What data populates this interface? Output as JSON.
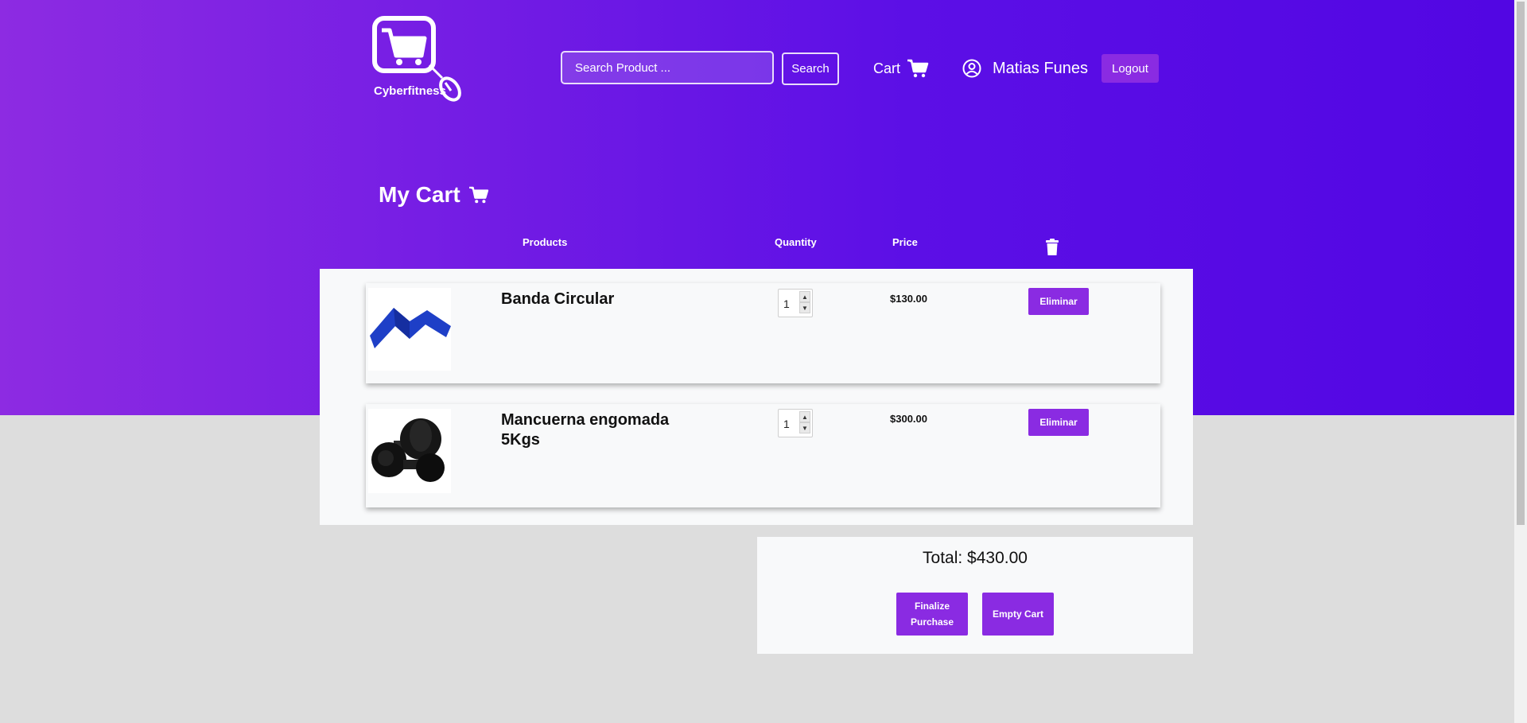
{
  "brand": {
    "name": "Cyberfitness"
  },
  "header": {
    "search_placeholder": "Search Product ...",
    "search_label": "Search",
    "cart_label": "Cart",
    "user_name": "Matias Funes",
    "logout_label": "Logout"
  },
  "cart": {
    "title": "My Cart",
    "columns": {
      "products": "Products",
      "quantity": "Quantity",
      "price": "Price"
    },
    "items": [
      {
        "name": "Banda Circular",
        "quantity": "1",
        "price": "$130.00",
        "remove_label": "Eliminar",
        "image": "blue-resistance-band"
      },
      {
        "name": "Mancuerna engomada 5Kgs",
        "quantity": "1",
        "price": "$300.00",
        "remove_label": "Eliminar",
        "image": "black-dumbbells"
      }
    ],
    "total": "Total: $430.00",
    "finalize_label": "Finalize Purchase",
    "empty_label": "Empty Cart"
  },
  "colors": {
    "accent": "#8a2be2",
    "gradient_start": "#8d2be2",
    "gradient_end": "#5206e3",
    "page_bg": "#dddddd"
  }
}
